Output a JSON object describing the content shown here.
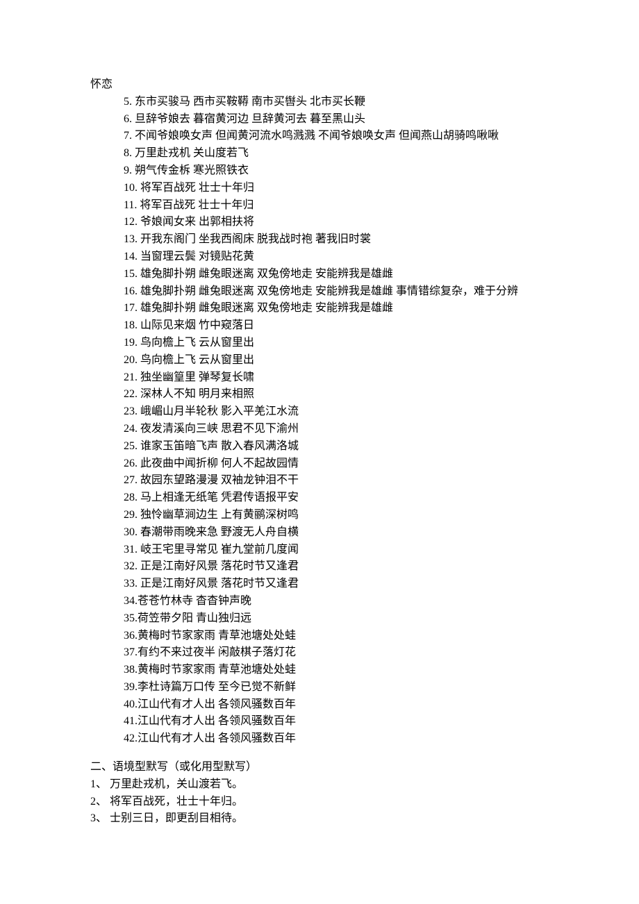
{
  "lines": [
    {
      "indent": 0,
      "text": "怀恋"
    },
    {
      "indent": 1,
      "text": "5. 东市买骏马 西市买鞍鞯 南市买辔头 北市买长鞭"
    },
    {
      "indent": 1,
      "text": "6. 旦辞爷娘去 暮宿黄河边 旦辞黄河去 暮至黑山头"
    },
    {
      "indent": 1,
      "text": "7. 不闻爷娘唤女声 但闻黄河流水鸣溅溅 不闻爷娘唤女声 但闻燕山胡骑鸣啾啾"
    },
    {
      "indent": 1,
      "text": "8. 万里赴戎机 关山度若飞"
    },
    {
      "indent": 1,
      "text": "9. 朔气传金柝 寒光照铁衣"
    },
    {
      "indent": 1,
      "text": "10. 将军百战死 壮士十年归"
    },
    {
      "indent": 1,
      "text": "11. 将军百战死 壮士十年归"
    },
    {
      "indent": 1,
      "text": "12. 爷娘闻女来 出郭相扶将"
    },
    {
      "indent": 1,
      "text": "13. 开我东阁门 坐我西阁床 脱我战时袍 著我旧时裳"
    },
    {
      "indent": 1,
      "text": "14. 当窗理云鬓 对镜贴花黄"
    },
    {
      "indent": 1,
      "text": "15. 雄兔脚扑朔 雌兔眼迷离 双兔傍地走 安能辨我是雄雌"
    },
    {
      "indent": 1,
      "text": "16. 雄兔脚扑朔 雌兔眼迷离 双兔傍地走 安能辨我是雄雌 事情错综复杂，难于分辨"
    },
    {
      "indent": 1,
      "text": "17. 雄兔脚扑朔 雌兔眼迷离 双兔傍地走 安能辨我是雄雌"
    },
    {
      "indent": 1,
      "text": "18. 山际见来烟 竹中窥落日"
    },
    {
      "indent": 1,
      "text": "19. 鸟向檐上飞 云从窗里出"
    },
    {
      "indent": 1,
      "text": "20. 鸟向檐上飞 云从窗里出"
    },
    {
      "indent": 1,
      "text": "21. 独坐幽篁里 弹琴复长啸"
    },
    {
      "indent": 1,
      "text": "22. 深林人不知 明月来相照"
    },
    {
      "indent": 1,
      "text": "23. 峨嵋山月半轮秋 影入平羌江水流"
    },
    {
      "indent": 1,
      "text": "24. 夜发清溪向三峡 思君不见下渝州"
    },
    {
      "indent": 1,
      "text": "25. 谁家玉笛暗飞声 散入春风满洛城"
    },
    {
      "indent": 1,
      "text": "26. 此夜曲中闻折柳 何人不起故园情"
    },
    {
      "indent": 1,
      "text": "27. 故园东望路漫漫 双袖龙钟泪不干"
    },
    {
      "indent": 1,
      "text": "28. 马上相逢无纸笔 凭君传语报平安"
    },
    {
      "indent": 1,
      "text": "29. 独怜幽草涧边生 上有黄鹂深树鸣"
    },
    {
      "indent": 1,
      "text": "30. 春潮带雨晚来急 野渡无人舟自横"
    },
    {
      "indent": 1,
      "text": "31. 岐王宅里寻常见 崔九堂前几度闻"
    },
    {
      "indent": 1,
      "text": "32. 正是江南好风景 落花时节又逢君"
    },
    {
      "indent": 1,
      "text": "33. 正是江南好风景 落花时节又逢君"
    },
    {
      "indent": 1,
      "text": "34.苍苍竹林寺 杳杳钟声晚"
    },
    {
      "indent": 1,
      "text": "35.荷笠带夕阳 青山独归远"
    },
    {
      "indent": 1,
      "text": "36.黄梅时节家家雨 青草池塘处处蛙"
    },
    {
      "indent": 1,
      "text": "37.有约不来过夜半 闲敲棋子落灯花"
    },
    {
      "indent": 1,
      "text": "38.黄梅时节家家雨 青草池塘处处蛙"
    },
    {
      "indent": 1,
      "text": "39.李杜诗篇万口传 至今已觉不新鲜"
    },
    {
      "indent": 1,
      "text": "40.江山代有才人出 各领风骚数百年"
    },
    {
      "indent": 1,
      "text": "41.江山代有才人出 各领风骚数百年"
    },
    {
      "indent": 1,
      "text": "42.江山代有才人出 各领风骚数百年"
    }
  ],
  "section2": {
    "heading": "二、语境型默写（或化用型默写）",
    "items": [
      "1、 万里赴戎机，关山渡若飞。",
      "2、 将军百战死，壮士十年归。",
      "3、 士别三日，即更刮目相待。"
    ]
  }
}
